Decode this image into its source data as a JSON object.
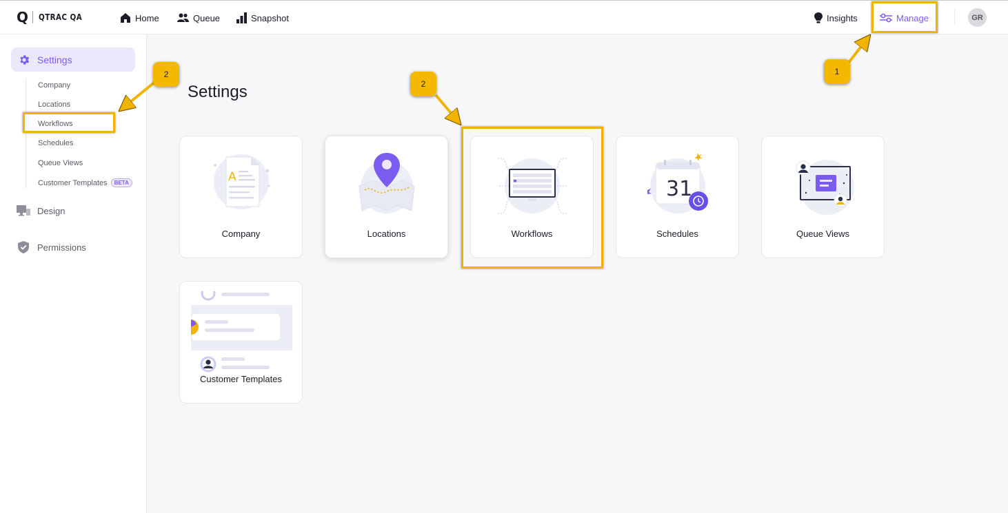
{
  "header": {
    "logo_mark": "Q",
    "app_name": "QTRAC QA",
    "nav": {
      "home": "Home",
      "queue": "Queue",
      "snapshot": "Snapshot",
      "insights": "Insights",
      "manage": "Manage"
    },
    "user_initials": "GR"
  },
  "sidebar": {
    "settings_label": "Settings",
    "sub_items": [
      {
        "label": "Company"
      },
      {
        "label": "Locations"
      },
      {
        "label": "Workflows"
      },
      {
        "label": "Schedules"
      },
      {
        "label": "Queue Views"
      },
      {
        "label": "Customer Templates",
        "badge": "BETA"
      }
    ],
    "design_label": "Design",
    "permissions_label": "Permissions"
  },
  "main": {
    "title": "Settings",
    "cards": [
      {
        "label": "Company"
      },
      {
        "label": "Locations"
      },
      {
        "label": "Workflows"
      },
      {
        "label": "Schedules",
        "art_text": "31"
      },
      {
        "label": "Queue Views"
      },
      {
        "label": "Customer Templates"
      }
    ]
  },
  "annotations": {
    "step1": "1",
    "step2_sidebar": "2",
    "step2_card": "2"
  },
  "colors": {
    "accent": "#7b5cf0",
    "highlight": "#f0b400",
    "badge": "#f5b800"
  },
  "icons": [
    "home-icon",
    "queue-icon",
    "snapshot-icon",
    "insights-icon",
    "manage-icon",
    "gear-icon",
    "design-icon",
    "shield-icon"
  ]
}
